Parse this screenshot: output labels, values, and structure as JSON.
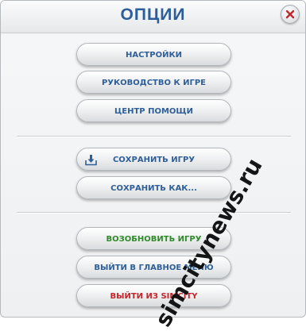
{
  "dialog": {
    "title": "ОПЦИИ"
  },
  "menu": {
    "group1": [
      {
        "label": "НАСТРОЙКИ"
      },
      {
        "label": "РУКОВОДСТВО К ИГРЕ"
      },
      {
        "label": "ЦЕНТР ПОМОЩИ"
      }
    ],
    "group2": [
      {
        "label": "СОХРАНИТЬ ИГРУ",
        "icon": "save-download-icon"
      },
      {
        "label": "СОХРАНИТЬ КАК..."
      }
    ],
    "group3": [
      {
        "label": "ВОЗОБНОВИТЬ ИГРУ",
        "color": "#2f8a2a"
      },
      {
        "label": "ВЫЙТИ В ГЛАВНОЕ МЕНЮ"
      },
      {
        "label": "ВЫЙТИ ИЗ SIMCITY",
        "color": "#c4262c"
      }
    ]
  },
  "watermark": "simcitynews.ru",
  "colors": {
    "title": "#2b5e9a",
    "button_text": "#2f5f98"
  }
}
